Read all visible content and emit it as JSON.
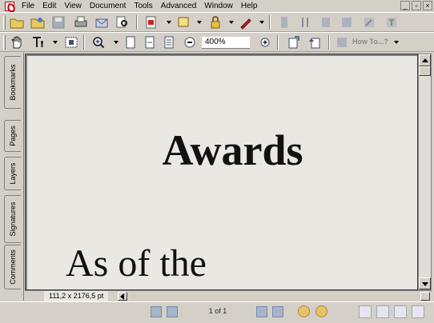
{
  "menu": {
    "items": [
      "File",
      "Edit",
      "View",
      "Document",
      "Tools",
      "Advanced",
      "Window",
      "Help"
    ]
  },
  "window_controls": {
    "minimize": "_",
    "restore": "▫",
    "close": "×"
  },
  "toolbar": {
    "zoom_value": "400%",
    "how_to_label": "How To...?"
  },
  "nav_tabs": [
    "Bookmarks",
    "Pages",
    "Layers",
    "Signatures",
    "Comments"
  ],
  "document": {
    "heading": "Awards",
    "body": "As of the"
  },
  "status": {
    "page_size": "111,2 x 2176,5 pt",
    "page_indicator": "1 of 1"
  },
  "colors": {
    "chrome": "#d4d0c8",
    "page_background": "#eae8e3",
    "text": "#111111"
  }
}
